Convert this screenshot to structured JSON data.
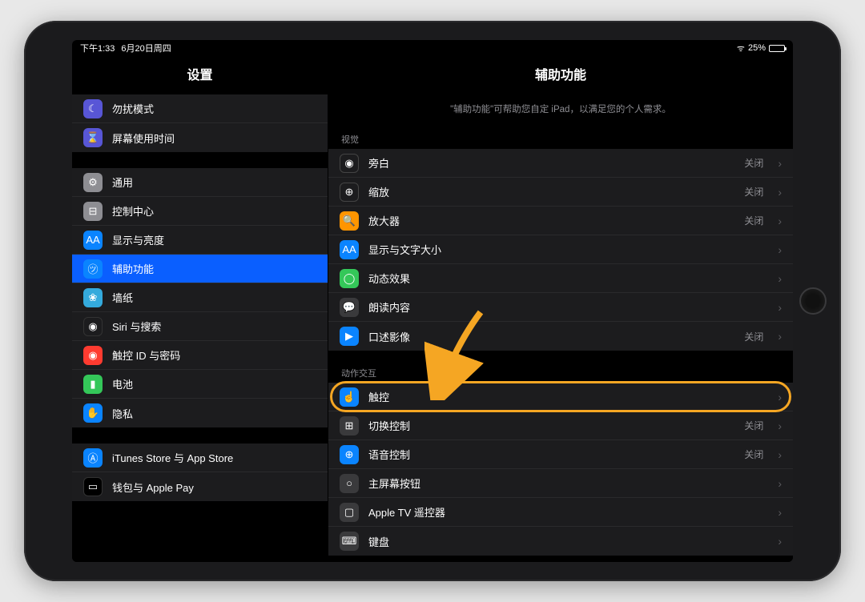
{
  "status": {
    "time": "下午1:33",
    "date": "6月20日周四",
    "battery_pct": "25%"
  },
  "sidebar": {
    "title": "设置",
    "group1": [
      {
        "id": "dnd",
        "label": "勿扰模式",
        "icon": "moon"
      },
      {
        "id": "screentime",
        "label": "屏幕使用时间",
        "icon": "hourglass"
      }
    ],
    "group2": [
      {
        "id": "general",
        "label": "通用",
        "icon": "gear"
      },
      {
        "id": "controlcenter",
        "label": "控制中心",
        "icon": "sliders"
      },
      {
        "id": "display",
        "label": "显示与亮度",
        "icon": "display"
      },
      {
        "id": "accessibility",
        "label": "辅助功能",
        "icon": "access",
        "selected": true
      },
      {
        "id": "wallpaper",
        "label": "墙纸",
        "icon": "wallpaper"
      },
      {
        "id": "siri",
        "label": "Siri 与搜索",
        "icon": "siri"
      },
      {
        "id": "touchid",
        "label": "触控 ID 与密码",
        "icon": "touchid"
      },
      {
        "id": "battery",
        "label": "电池",
        "icon": "battery"
      },
      {
        "id": "privacy",
        "label": "隐私",
        "icon": "privacy"
      }
    ],
    "group3": [
      {
        "id": "appstore",
        "label": "iTunes Store 与 App Store",
        "icon": "appstore"
      },
      {
        "id": "wallet",
        "label": "钱包与 Apple Pay",
        "icon": "wallet"
      }
    ]
  },
  "detail": {
    "title": "辅助功能",
    "description": "\"辅助功能\"可帮助您自定 iPad，以满足您的个人需求。",
    "sections": [
      {
        "header": "视觉",
        "rows": [
          {
            "label": "旁白",
            "status": "关闭",
            "icon": "voiceover"
          },
          {
            "label": "缩放",
            "status": "关闭",
            "icon": "zoom"
          },
          {
            "label": "放大器",
            "status": "关闭",
            "icon": "mag"
          },
          {
            "label": "显示与文字大小",
            "status": "",
            "icon": "text"
          },
          {
            "label": "动态效果",
            "status": "",
            "icon": "motion"
          },
          {
            "label": "朗读内容",
            "status": "",
            "icon": "speak"
          },
          {
            "label": "口述影像",
            "status": "关闭",
            "icon": "desc"
          }
        ]
      },
      {
        "header": "动作交互",
        "rows": [
          {
            "label": "触控",
            "status": "",
            "icon": "touch",
            "highlighted": true
          },
          {
            "label": "切换控制",
            "status": "关闭",
            "icon": "switch"
          },
          {
            "label": "语音控制",
            "status": "关闭",
            "icon": "voice"
          },
          {
            "label": "主屏幕按钮",
            "status": "",
            "icon": "home"
          },
          {
            "label": "Apple TV 遥控器",
            "status": "",
            "icon": "tv"
          },
          {
            "label": "键盘",
            "status": "",
            "icon": "kb"
          }
        ]
      }
    ]
  },
  "icons": {
    "moon": "☾",
    "hourglass": "⌛",
    "gear": "⚙",
    "sliders": "⊟",
    "display": "AA",
    "access": "㋡",
    "wallpaper": "❀",
    "siri": "◉",
    "touchid": "◉",
    "battery": "▮",
    "privacy": "✋",
    "appstore": "Ⓐ",
    "wallet": "▭",
    "voiceover": "◉",
    "zoom": "⊕",
    "mag": "🔍",
    "text": "AA",
    "motion": "◯",
    "speak": "💬",
    "desc": "▶",
    "touch": "☝",
    "switch": "⊞",
    "voice": "⊕",
    "home": "○",
    "tv": "▢",
    "kb": "⌨"
  }
}
